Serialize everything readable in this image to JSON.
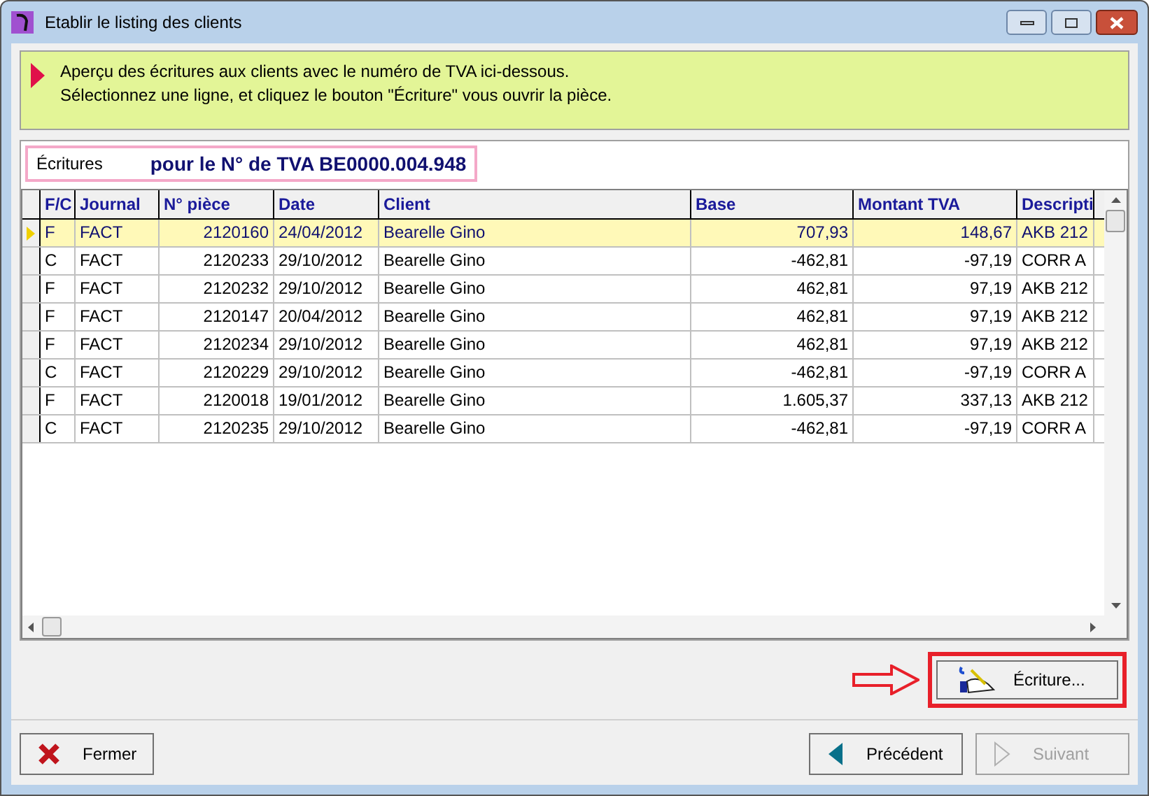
{
  "window": {
    "title": "Etablir le listing des clients"
  },
  "info": {
    "lines": [
      "Aperçu des écritures aux clients avec le numéro de TVA ici-dessous.",
      "Sélectionnez une ligne, et cliquez le bouton \"Écriture\" vous ouvrir la pièce."
    ]
  },
  "header": {
    "label": "Écritures",
    "vat": "pour le N° de TVA BE0000.004.948"
  },
  "table": {
    "columns": [
      "F/C",
      "Journal",
      "N° pièce",
      "Date",
      "Client",
      "Base",
      "Montant TVA",
      "Descripti"
    ],
    "rows": [
      {
        "fc": "F",
        "journal": "FACT",
        "piece": "2120160",
        "date": "24/04/2012",
        "client": "Bearelle Gino",
        "base": "707,93",
        "vat": "148,67",
        "description": "AKB 212",
        "selected": true
      },
      {
        "fc": "C",
        "journal": "FACT",
        "piece": "2120233",
        "date": "29/10/2012",
        "client": "Bearelle Gino",
        "base": "-462,81",
        "vat": "-97,19",
        "description": "CORR A",
        "selected": false
      },
      {
        "fc": "F",
        "journal": "FACT",
        "piece": "2120232",
        "date": "29/10/2012",
        "client": "Bearelle Gino",
        "base": "462,81",
        "vat": "97,19",
        "description": "AKB 212",
        "selected": false
      },
      {
        "fc": "F",
        "journal": "FACT",
        "piece": "2120147",
        "date": "20/04/2012",
        "client": "Bearelle Gino",
        "base": "462,81",
        "vat": "97,19",
        "description": "AKB 212",
        "selected": false
      },
      {
        "fc": "F",
        "journal": "FACT",
        "piece": "2120234",
        "date": "29/10/2012",
        "client": "Bearelle Gino",
        "base": "462,81",
        "vat": "97,19",
        "description": "AKB 212",
        "selected": false
      },
      {
        "fc": "C",
        "journal": "FACT",
        "piece": "2120229",
        "date": "29/10/2012",
        "client": "Bearelle Gino",
        "base": "-462,81",
        "vat": "-97,19",
        "description": "CORR A",
        "selected": false
      },
      {
        "fc": "F",
        "journal": "FACT",
        "piece": "2120018",
        "date": "19/01/2012",
        "client": "Bearelle Gino",
        "base": "1.605,37",
        "vat": "337,13",
        "description": "AKB 212",
        "selected": false
      },
      {
        "fc": "C",
        "journal": "FACT",
        "piece": "2120235",
        "date": "29/10/2012",
        "client": "Bearelle Gino",
        "base": "-462,81",
        "vat": "-97,19",
        "description": "CORR A",
        "selected": false
      }
    ]
  },
  "ecriture_button": {
    "label": "Écriture...",
    "highlighted": true
  },
  "buttons": [
    {
      "label": "Fermer",
      "kind": "close",
      "disabled": false
    },
    {
      "label": "Précédent",
      "kind": "previous",
      "disabled": false
    },
    {
      "label": "Suivant",
      "kind": "next",
      "disabled": true
    }
  ]
}
